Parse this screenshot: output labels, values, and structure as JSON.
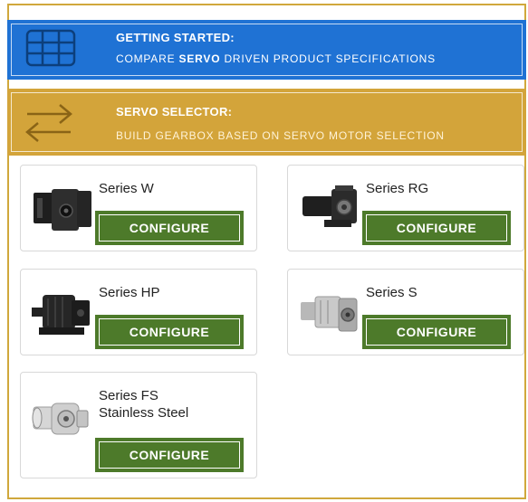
{
  "getting_started": {
    "title": "GETTING STARTED:",
    "subtitle_pre": "COMPARE ",
    "subtitle_bold": "SERVO",
    "subtitle_post": " DRIVEN PRODUCT SPECIFICATIONS",
    "icon": "grid-table-icon",
    "color": "#1f72d4"
  },
  "servo_selector": {
    "title": "SERVO SELECTOR:",
    "subtitle": "BUILD GEARBOX BASED ON SERVO MOTOR SELECTION",
    "icon": "swap-arrows-icon",
    "color": "#d3a43a"
  },
  "products": [
    {
      "name": "Series W",
      "button": "CONFIGURE"
    },
    {
      "name": "Series RG",
      "button": "CONFIGURE"
    },
    {
      "name": "Series HP",
      "button": "CONFIGURE"
    },
    {
      "name": "Series S",
      "button": "CONFIGURE"
    },
    {
      "name_line1": "Series FS",
      "name_line2": "Stainless Steel",
      "button": "CONFIGURE"
    }
  ],
  "colors": {
    "button_green": "#4d7a2a",
    "frame_gold": "#d0a83c"
  }
}
